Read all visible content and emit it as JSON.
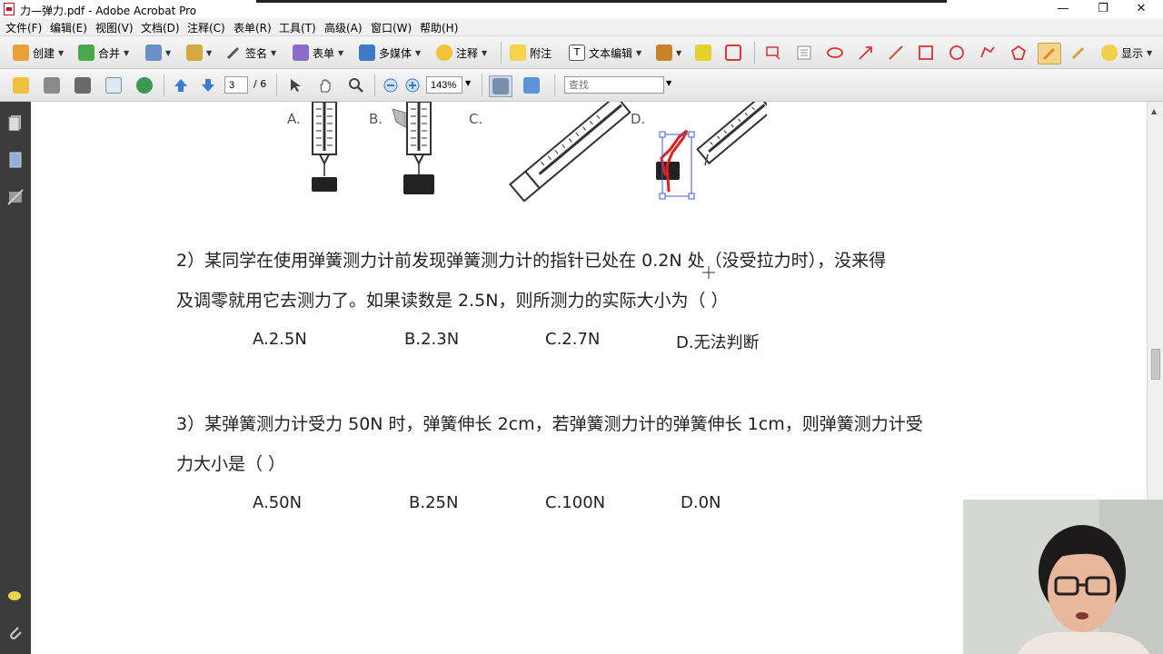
{
  "window": {
    "title": "力—弹力.pdf - Adobe Acrobat Pro",
    "controls": [
      "—",
      "❐",
      "✕"
    ]
  },
  "menu": [
    "文件(F)",
    "编辑(E)",
    "视图(V)",
    "文档(D)",
    "注释(C)",
    "表单(R)",
    "工具(T)",
    "高级(A)",
    "窗口(W)",
    "帮助(H)"
  ],
  "toolbar1": {
    "create": "创建",
    "combine": "合并",
    "sign": "签名",
    "forms": "表单",
    "multimedia": "多媒体",
    "comment": "注释",
    "note": "附注",
    "text_edit": "文本编辑",
    "display": "显示"
  },
  "toolbar2": {
    "page_current": "3",
    "page_total": "/ 6",
    "zoom": "143%",
    "search_placeholder": "查找"
  },
  "figure": {
    "labels": [
      "A.",
      "B.",
      "C.",
      "D."
    ]
  },
  "questions": [
    {
      "line1": "2）某同学在使用弹簧测力计前发现弹簧测力计的指针已处在 0.2N 处（没受拉力时），没来得",
      "line2": "及调零就用它去测力了。如果读数是 2.5N，则所测力的实际大小为（      ）",
      "options": [
        "A.2.5N",
        "B.2.3N",
        "C.2.7N",
        "D.无法判断"
      ]
    },
    {
      "line1": "3）某弹簧测力计受力 50N 时，弹簧伸长 2cm，若弹簧测力计的弹簧伸长 1cm，则弹簧测力计受",
      "line2": "力大小是（       ）",
      "options": [
        "A.50N",
        "B.25N",
        "C.100N",
        "D.0N"
      ]
    }
  ],
  "colors": {
    "accent_annotation": "#e0201c",
    "nav_bg": "#3c3c3c",
    "selection_handles": "#3b5bdb"
  }
}
